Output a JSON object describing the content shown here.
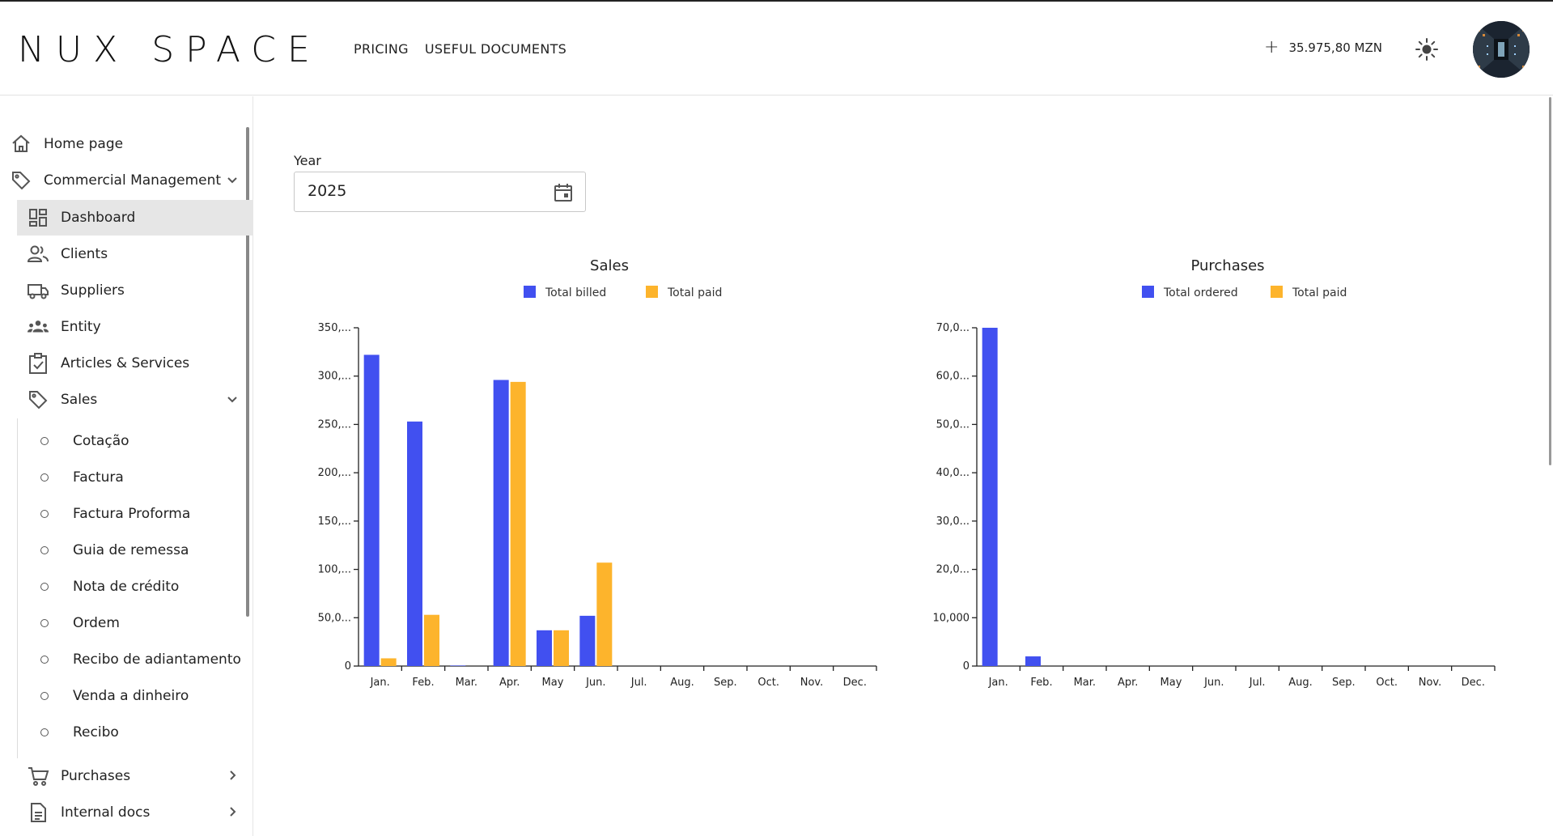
{
  "header": {
    "logo": "NUX SPACE",
    "nav": [
      "PRICING",
      "USEFUL DOCUMENTS"
    ],
    "balance_plus": "+",
    "balance": "35.975,80 MZN",
    "theme_icon": "sun-icon",
    "avatar_icon": "user-avatar"
  },
  "sidebar": {
    "items": [
      {
        "label": "Home page",
        "icon": "home-icon"
      },
      {
        "label": "Commercial Management",
        "icon": "tag-icon"
      },
      {
        "label": "Dashboard",
        "icon": "dashboard-icon"
      },
      {
        "label": "Clients",
        "icon": "people-icon"
      },
      {
        "label": "Suppliers",
        "icon": "truck-icon"
      },
      {
        "label": "Entity",
        "icon": "groups-icon"
      },
      {
        "label": "Articles & Services",
        "icon": "clipboard-check-icon"
      },
      {
        "label": "Sales",
        "icon": "tag-icon"
      },
      {
        "label": "Purchases",
        "icon": "cart-icon"
      },
      {
        "label": "Internal docs",
        "icon": "document-icon"
      }
    ],
    "sales_sub": [
      "Cotação",
      "Factura",
      "Factura Proforma",
      "Guia de remessa",
      "Nota de crédito",
      "Ordem",
      "Recibo de adiantamento",
      "Venda a dinheiro",
      "Recibo"
    ]
  },
  "filter": {
    "year_label": "Year",
    "year_value": "2025"
  },
  "colors": {
    "blue": "#4150F0",
    "orange": "#FDB42C"
  },
  "chart_data": [
    {
      "type": "bar",
      "title": "Sales",
      "categories": [
        "Jan.",
        "Feb.",
        "Mar.",
        "Apr.",
        "May",
        "Jun.",
        "Jul.",
        "Aug.",
        "Sep.",
        "Oct.",
        "Nov.",
        "Dec."
      ],
      "series": [
        {
          "name": "Total billed",
          "color": "#4150F0",
          "values": [
            322000,
            253000,
            500,
            296000,
            37000,
            52000,
            0,
            0,
            0,
            0,
            0,
            0
          ]
        },
        {
          "name": "Total paid",
          "color": "#FDB42C",
          "values": [
            8000,
            53000,
            0,
            294000,
            37000,
            107000,
            0,
            0,
            0,
            0,
            0,
            0
          ]
        }
      ],
      "yticks": [
        "0",
        "50,0...",
        "100,...",
        "150,...",
        "200,...",
        "250,...",
        "300,...",
        "350,..."
      ],
      "ylim": [
        0,
        350000
      ],
      "legend": "top-center"
    },
    {
      "type": "bar",
      "title": "Purchases",
      "categories": [
        "Jan.",
        "Feb.",
        "Mar.",
        "Apr.",
        "May",
        "Jun.",
        "Jul.",
        "Aug.",
        "Sep.",
        "Oct.",
        "Nov.",
        "Dec."
      ],
      "series": [
        {
          "name": "Total ordered",
          "color": "#4150F0",
          "values": [
            70000,
            2000,
            0,
            0,
            0,
            0,
            0,
            0,
            0,
            0,
            0,
            0
          ]
        },
        {
          "name": "Total paid",
          "color": "#FDB42C",
          "values": [
            0,
            0,
            0,
            0,
            0,
            0,
            0,
            0,
            0,
            0,
            0,
            0
          ]
        }
      ],
      "yticks": [
        "0",
        "10,000",
        "20,0...",
        "30,0...",
        "40,0...",
        "50,0...",
        "60,0...",
        "70,0..."
      ],
      "ylim": [
        0,
        70000
      ],
      "legend": "top-center"
    }
  ]
}
